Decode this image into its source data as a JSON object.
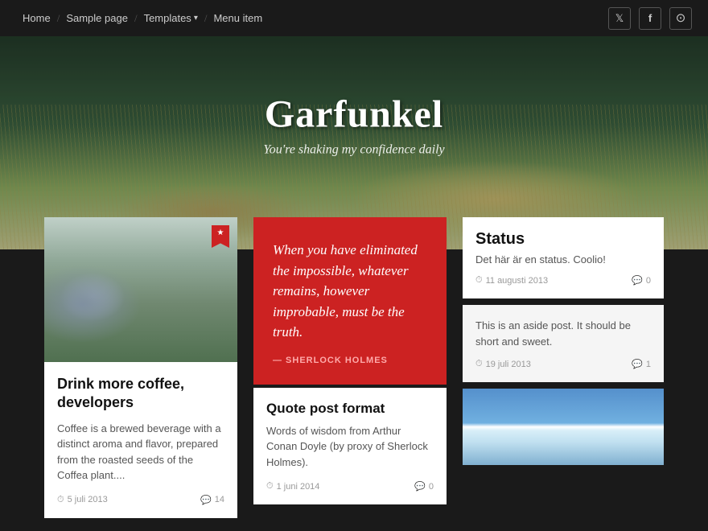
{
  "nav": {
    "items": [
      {
        "label": "Home",
        "id": "home"
      },
      {
        "label": "Sample page",
        "id": "sample-page"
      },
      {
        "label": "Templates",
        "id": "templates",
        "hasDropdown": true
      },
      {
        "label": "Menu item",
        "id": "menu-item"
      }
    ],
    "social": [
      {
        "icon": "🐦",
        "name": "twitter"
      },
      {
        "icon": "f",
        "name": "facebook"
      },
      {
        "icon": "📷",
        "name": "instagram"
      }
    ]
  },
  "hero": {
    "title": "Garfunkel",
    "subtitle": "You're shaking my confidence daily"
  },
  "cards": {
    "post1": {
      "title": "Drink more coffee, developers",
      "excerpt": "Coffee is a brewed beverage with a distinct aroma and flavor, prepared from the roasted seeds of the Coffea plant....",
      "date": "5 juli 2013",
      "comments": "14"
    },
    "quote": {
      "text": "When you have eliminated the impossible, whatever remains, however improbable, must be the truth.",
      "author": "— SHERLOCK HOLMES"
    },
    "quotePost": {
      "title": "Quote post format",
      "excerpt": "Words of wisdom from Arthur Conan Doyle (by proxy of Sherlock Holmes).",
      "date": "1 juni 2014",
      "comments": "0"
    },
    "status": {
      "title": "Status",
      "text": "Det här är en status. Coolio!",
      "date": "11 augusti 2013",
      "comments": "0"
    },
    "aside": {
      "text": "This is an aside post. It should be short and sweet.",
      "date": "19 juli 2013",
      "comments": "1"
    }
  }
}
